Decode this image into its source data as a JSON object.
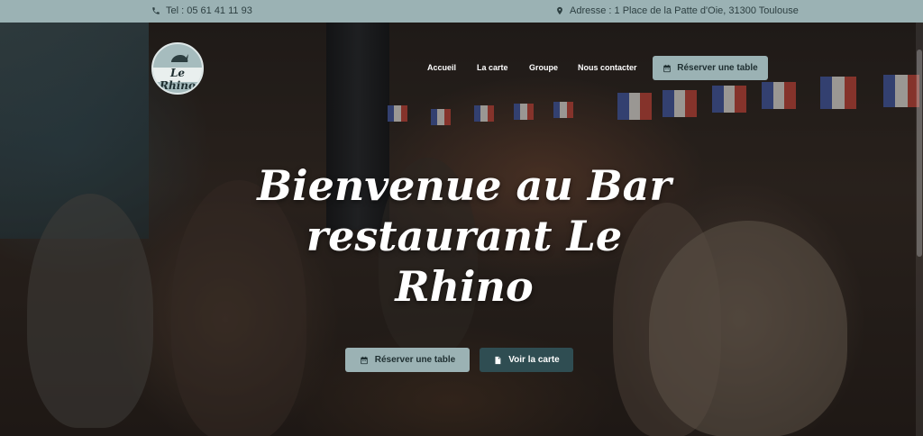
{
  "topbar": {
    "phone": "Tel : 05 61 41 11 93",
    "phone_icon": "phone-icon",
    "address": "Adresse : 1 Place de la Patte d'Oie, 31300 Toulouse",
    "address_icon": "map-pin-icon"
  },
  "logo": {
    "name": "Le Rhino"
  },
  "nav": {
    "items": [
      {
        "label": "Accueil"
      },
      {
        "label": "La carte"
      },
      {
        "label": "Groupe"
      },
      {
        "label": "Nous contacter"
      }
    ],
    "reserve_label": "Réserver une table",
    "reserve_icon": "calendar-icon"
  },
  "hero": {
    "headline_line1": "Bienvenue au Bar",
    "headline_line2": "restaurant Le",
    "headline_line3": "Rhino",
    "reserve_label": "Réserver une table",
    "reserve_icon": "calendar-icon",
    "menu_label": "Voir la carte",
    "menu_icon": "document-icon"
  },
  "colors": {
    "accent": "#9bb2b4",
    "dark_button": "#2f4d52"
  }
}
